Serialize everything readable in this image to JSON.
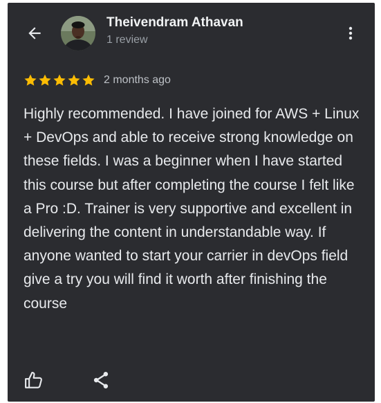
{
  "header": {
    "back_icon": "arrow-back-icon",
    "reviewer_name": "Theivendram Athavan",
    "review_count": "1 review",
    "more_icon": "more-vert-icon"
  },
  "review": {
    "rating": 5,
    "rating_max": 5,
    "star_color": "#fbbc04",
    "time_ago": "2 months ago",
    "text": "Highly recommended. I have joined for AWS + Linux + DevOps and able to receive strong knowledge on these fields. I was a beginner when I have started this course but after completing the course I felt like a Pro :D. Trainer is very supportive and excellent in delivering the content in understandable way. If anyone wanted to start your carrier in devOps field give a try you will find it worth after finishing the course"
  },
  "actions": {
    "like_icon": "thumb-up-icon",
    "share_icon": "share-icon"
  },
  "colors": {
    "card_background": "#2b2c30",
    "primary_text": "#e8eaed",
    "secondary_text": "#9aa0a6"
  }
}
